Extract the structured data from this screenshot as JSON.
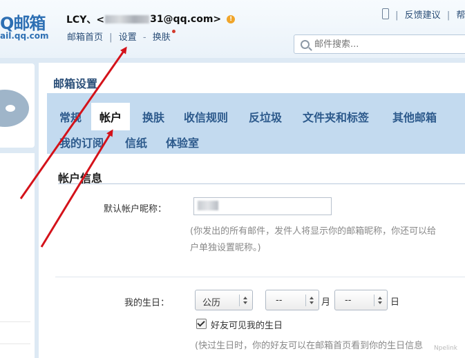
{
  "header": {
    "logo_main": "Q邮箱",
    "logo_sub": "ail.qq.com",
    "account_prefix": "LCY、<",
    "account_suffix": "31@qq.com>",
    "links": [
      "邮箱首页",
      "设置",
      "换肤"
    ],
    "separator_pipe": "|",
    "separator_dash": "-",
    "right_links": [
      "反馈建议",
      "帮"
    ]
  },
  "search": {
    "placeholder": "邮件搜索..."
  },
  "panel": {
    "title": "邮箱设置",
    "tabs": [
      "常规",
      "帐户",
      "换肤",
      "收信规则",
      "反垃圾",
      "文件夹和标签",
      "其他邮箱",
      "我的订阅",
      "信纸",
      "体验室"
    ],
    "active_tab": "帐户"
  },
  "account_info": {
    "section_title": "帐户信息",
    "nickname_label": "默认帐户昵称：",
    "nickname_hint_1": "(你发出的所有邮件，发件人将显示你的邮箱昵称，你还可以给",
    "nickname_hint_2": "户单独设置昵称。)",
    "birthday_label": "我的生日：",
    "calendar_value": "公历",
    "month_value": "--",
    "month_unit": "月",
    "day_value": "--",
    "day_unit": "日",
    "friends_checkbox_label": "好友可见我的生日",
    "friends_checked": true,
    "birthday_hint": "(快过生日时，你的好友可以在邮箱首页看到你的生日信息"
  },
  "watermark": "Npelink",
  "colors": {
    "annotation_arrow": "#d4121a",
    "tab_bar": "#c3daef",
    "link": "#2c4f78"
  }
}
